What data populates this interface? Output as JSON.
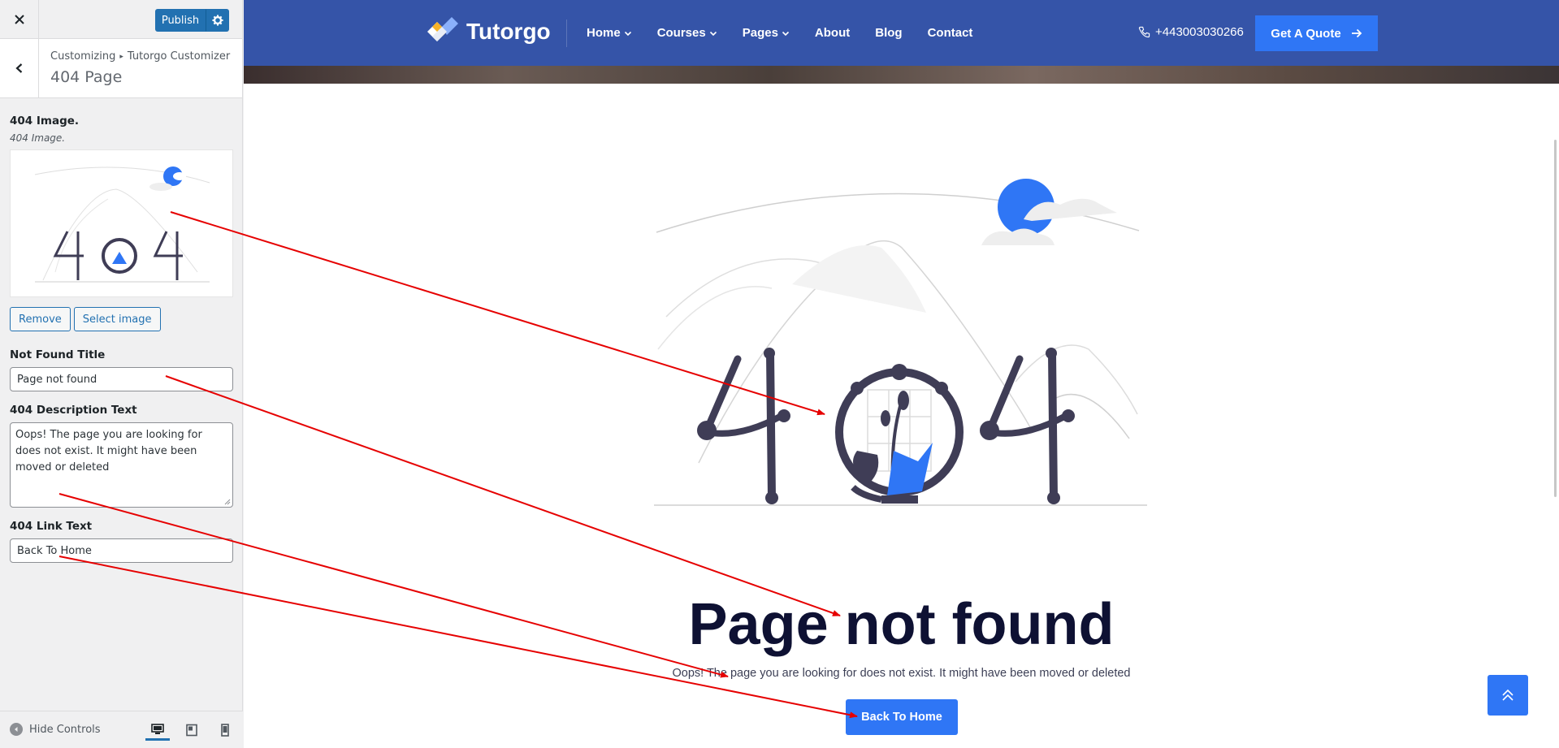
{
  "sidebar": {
    "publish_label": "Publish",
    "breadcrumb_root": "Customizing",
    "breadcrumb_separator": "▸",
    "breadcrumb_panel": "Tutorgo Customizer",
    "section_title": "404 Page",
    "image_label": "404 Image.",
    "image_desc": "404 Image.",
    "remove_label": "Remove",
    "select_image_label": "Select image",
    "title_label": "Not Found Title",
    "title_value": "Page not found",
    "desc_label": "404 Description Text",
    "desc_value": "Oops! The page you are looking for does not exist. It might have been moved or deleted",
    "link_label": "404 Link Text",
    "link_value": "Back To Home",
    "hide_controls": "Hide Controls"
  },
  "header": {
    "logo_text": "Tutorgo",
    "nav": [
      {
        "label": "Home"
      },
      {
        "label": "Courses"
      },
      {
        "label": "Pages"
      },
      {
        "label": "About"
      },
      {
        "label": "Blog"
      },
      {
        "label": "Contact"
      }
    ],
    "phone": "+443003030266",
    "quote_label": "Get A Quote"
  },
  "main": {
    "title": "Page not found",
    "description": "Oops! The page you are looking for does not exist. It might have been moved or deleted",
    "link_text": "Back To Home"
  },
  "colors": {
    "header_bg": "#3554a8",
    "accent": "#2f76f5",
    "wp_blue": "#2271b1",
    "annotation": "#e60000"
  }
}
